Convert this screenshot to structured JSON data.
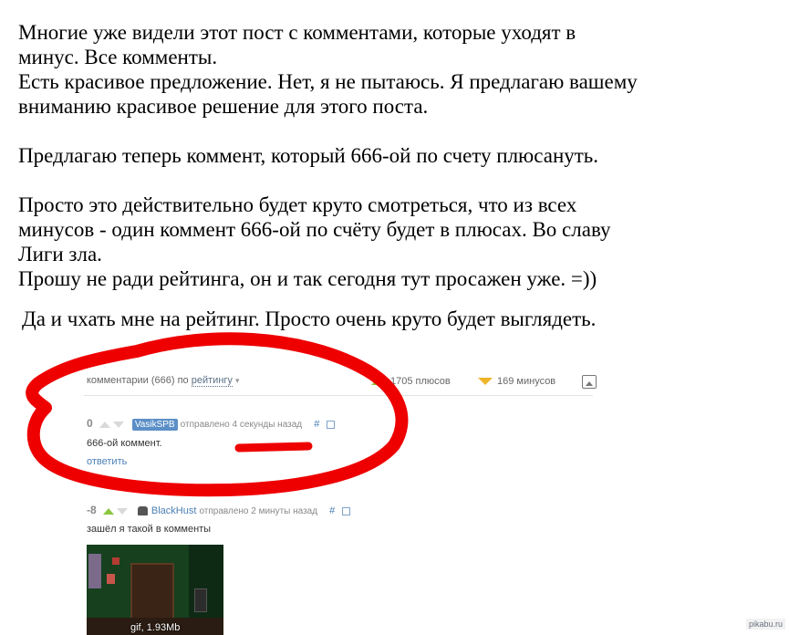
{
  "post": {
    "lines": [
      "Многие уже видели этот пост с комментами, которые уходят в",
      "минус. Все комменты.",
      "Есть красивое предложение. Нет, я не пытаюсь. Я предлагаю вашему",
      "вниманию красивое решение для этого поста.",
      "Предлагаю теперь коммент, который 666-ой по счету плюсануть.",
      "Просто это действительно будет круто смотреться, что из всех",
      "минусов - один коммент 666-ой по счёту будет в плюсах. Во славу",
      "Лиги зла.",
      "Прошу не ради рейтинга, он и так сегодня тут просажен уже. =))",
      "Да и чхать мне на рейтинг. Просто очень круто будет выглядеть."
    ]
  },
  "comments_header": {
    "label": "комментарии (666) по",
    "sort_value": "рейтингу",
    "plus_count": "1705 плюсов",
    "minus_count": "169 минусов"
  },
  "comments": [
    {
      "rating": "0",
      "author": "VasikSPB",
      "meta": "отправлено 4 секунды назад",
      "hash": "#",
      "text": "666-ой коммент.",
      "reply": "ответить"
    },
    {
      "rating": "-8",
      "author": "BlackHust",
      "meta": "отправлено 2 минуты назад",
      "hash": "#",
      "text": "зашёл я такой в комменты",
      "attachment": "gif, 1.93Mb"
    }
  ],
  "watermark": "pikabu.ru",
  "colors": {
    "annotation_red": "#ee0000",
    "plus_green": "#8cc63f",
    "minus_orange": "#f0b429",
    "link_blue": "#4a7fb5"
  },
  "icons": [
    "plus-triangle-icon",
    "minus-triangle-icon",
    "image-icon",
    "upvote-icon",
    "downvote-icon",
    "save-icon",
    "avatar-icon"
  ]
}
